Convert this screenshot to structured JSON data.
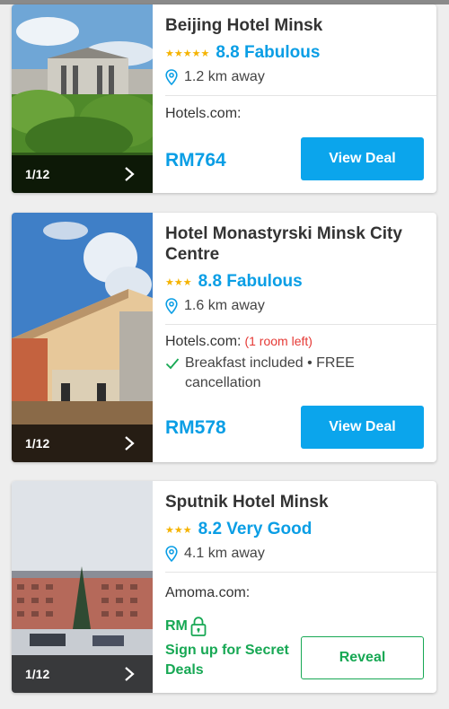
{
  "colors": {
    "accent_blue": "#0ba5ec",
    "score_blue": "#0a9ee5",
    "secret_green": "#17a854",
    "rooms_left_red": "#e53935",
    "star_yellow": "#f5b301"
  },
  "hotels": [
    {
      "name": "Beijing Hotel Minsk",
      "stars_display": "★★★★★",
      "star_count": 5,
      "score": "8.8 Fabulous",
      "distance": "1.2 km away",
      "photo_counter": "1/12",
      "provider": "Hotels.com:",
      "price": "RM764",
      "button_label": "View Deal"
    },
    {
      "name": "Hotel Monastyrski Minsk City Centre",
      "stars_display": "★★★",
      "star_count": 3,
      "score": "8.8 Fabulous",
      "distance": "1.6 km away",
      "photo_counter": "1/12",
      "provider": "Hotels.com:",
      "rooms_left": "(1 room left)",
      "perk": "Breakfast included • FREE cancellation",
      "price": "RM578",
      "button_label": "View Deal"
    },
    {
      "name": "Sputnik Hotel Minsk",
      "stars_display": "★★★",
      "star_count": 3,
      "score": "8.2 Very Good",
      "distance": "4.1 km away",
      "photo_counter": "1/12",
      "provider": "Amoma.com:",
      "secret_currency": "RM",
      "secret_label": "Sign up for Secret Deals",
      "button_label": "Reveal"
    }
  ]
}
